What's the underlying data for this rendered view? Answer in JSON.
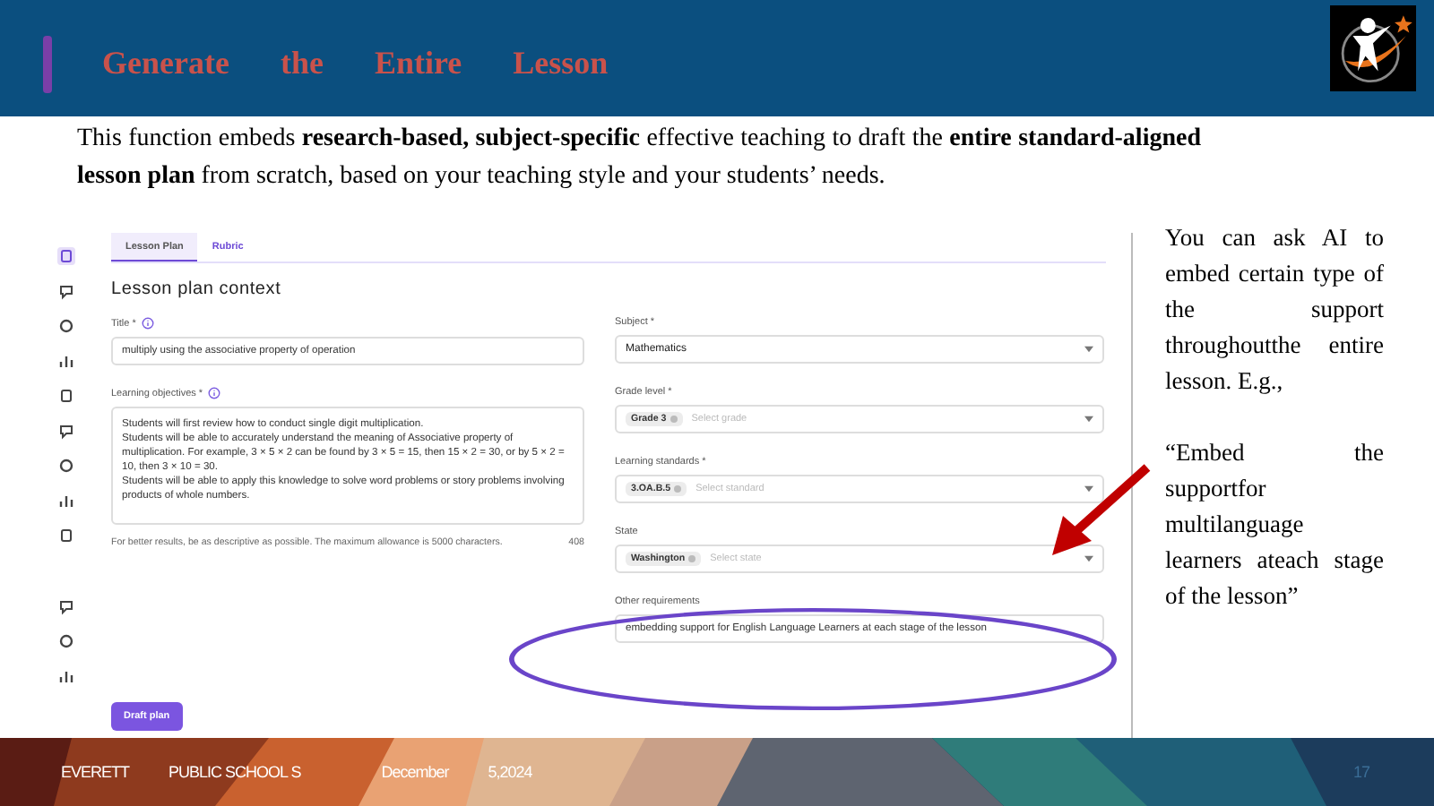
{
  "header": {
    "title": "Generate the Entire Lesson"
  },
  "intro": "This function embeds **research-based, subject-specific** effective teaching to draft the **entire standard-aligned lesson plan** from scratch, based on your teaching style and your students’ needs.",
  "app": {
    "nav": [
      {
        "selected": true
      },
      {
        "selected": false
      },
      {
        "selected": false
      },
      {
        "selected": false
      },
      {
        "selected": false
      },
      {
        "selected": false
      },
      {
        "selected": false
      },
      {
        "selected": false
      },
      {
        "selected": false
      },
      {
        "selected": false
      },
      {
        "selected": false
      },
      {
        "selected": false
      }
    ],
    "tabs": [
      {
        "label": "Lesson Plan",
        "selected": true
      },
      {
        "label": "Rubric",
        "selected": false
      }
    ],
    "heading": "Lesson plan context",
    "title_field": {
      "label": "Title *",
      "value": "multiply using the associative property of operation"
    },
    "objectives_field": {
      "label": "Learning objectives *",
      "value": "Students will first review how to conduct single digit multiplication.\nStudents will be able to accurately understand the meaning of Associative property of multiplication. For example, 3 × 5 × 2 can be found by 3 × 5 = 15, then 15 × 2 = 30, or by 5 × 2 = 10, then 3 × 10 = 30.\nStudents will be able to apply this knowledge to solve word problems or story problems involving products of whole numbers."
    },
    "hint": "For better results, be as descriptive as possible. The maximum allowance is 5000 characters.",
    "counter": "408",
    "right_fields": [
      {
        "kind": "select",
        "label": "Subject *",
        "value": "Mathematics"
      },
      {
        "kind": "multi",
        "label": "Grade level *",
        "chip": "Grade 3",
        "placeholder": "Select grade"
      },
      {
        "kind": "multi",
        "label": "Learning standards *",
        "chip": "3.OA.B.5",
        "placeholder": "Select standard"
      },
      {
        "kind": "multi",
        "label": "State",
        "chip": "Washington",
        "placeholder": "Select state"
      },
      {
        "kind": "text",
        "label": "Other requirements",
        "value": "embedding support for English Language Learners at each stage of the lesson"
      }
    ],
    "button": "Draft plan"
  },
  "side_note": "You can ask AI to embed certain type of the support throughoutthe entire lesson. E.g.,",
  "side_quote": "“Embed the supportfor multilanguage learners ateach stage of the lesson”",
  "footer": {
    "org": "EVERETT",
    "org2": "PUBLIC SCHOOL S",
    "month": "December",
    "date": "5,2024",
    "page": "17"
  }
}
